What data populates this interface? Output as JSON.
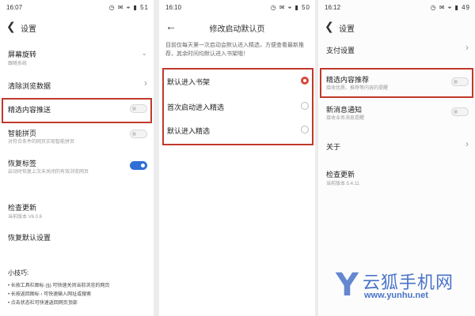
{
  "panels": [
    {
      "status": {
        "time": "16:07",
        "icons": "◷ ✉ ⌖ ▮ 51"
      },
      "header": {
        "back": "❮",
        "title": "设置"
      },
      "items": [
        {
          "label": "屏幕旋转",
          "sub": "跟随系统",
          "control": "⌄"
        },
        {
          "label": "清除浏览数据",
          "control": "›"
        },
        {
          "label": "精选内容推送",
          "control": "toggle-off"
        },
        {
          "label": "智能拼页",
          "sub": "对符合条件的网页实现智能拼页",
          "control": "toggle-off"
        },
        {
          "label": "恢复标签",
          "sub": "启动时恢复上次未关闭的有效浏览网页",
          "control": "toggle-on"
        },
        {
          "label": "检查更新",
          "sub": "当前版本 V6.0.6"
        },
        {
          "label": "恢复默认设置"
        }
      ],
      "tips": {
        "title": "小技巧:",
        "lines": [
          "• 长按工具栏图标 (§) 可快速关闭当前浏览的网页",
          "• 长按返回图标 ‹ 可快速输入网址或搜索",
          "• 点击状态栏可快速返回网页顶部"
        ]
      }
    },
    {
      "status": {
        "time": "16:10",
        "icons": "◷ ✉ ⌖ ▮ 50"
      },
      "header": {
        "back": "←",
        "title": "修改启动默认页"
      },
      "description": "目前仅每天第一次启动会默认进入精选，方便查看最新推荐，其余时间均默认进入书架哦！",
      "options": [
        {
          "label": "默认进入书架",
          "selected": true
        },
        {
          "label": "首次启动进入精选",
          "selected": false
        },
        {
          "label": "默认进入精选",
          "selected": false
        }
      ]
    },
    {
      "status": {
        "time": "16:12",
        "icons": "◷ ✉ ⌖ ▮ 49"
      },
      "header": {
        "back": "❮",
        "title": "设置"
      },
      "items": [
        {
          "label": "支付设置",
          "control": "›"
        },
        {
          "label": "精选内容推荐",
          "sub": "接收优质、推荐等内容的提醒",
          "control": "toggle-off"
        },
        {
          "label": "新消息通知",
          "sub": "接收业务消息提醒",
          "control": "toggle-off"
        },
        {
          "label": "关于",
          "control": "›"
        },
        {
          "label": "检查更新",
          "sub": "当前版本 5.4.11"
        }
      ]
    }
  ],
  "watermark": {
    "logo": "Y",
    "name": "云狐手机网",
    "url": "www.yunhu.net"
  },
  "colors": {
    "highlight": "#c0392b",
    "toggle_on": "#2f6fd6",
    "radio_on": "#d9473b",
    "watermark": "#4a73c9"
  }
}
